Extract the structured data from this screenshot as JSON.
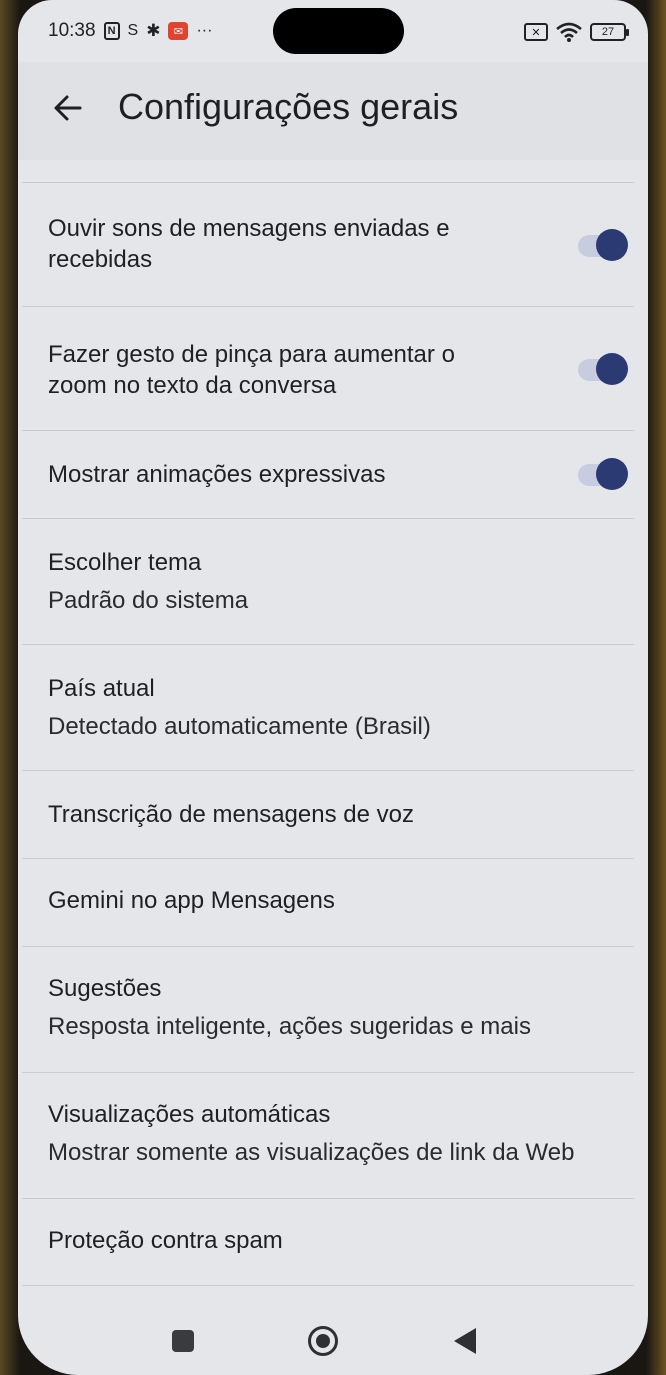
{
  "status_bar": {
    "time": "10:38",
    "icons_left": [
      "nfc-icon",
      "s-icon",
      "gear-icon",
      "mail-icon",
      "more-icon"
    ],
    "icons_right": [
      "sim-icon",
      "wifi-icon",
      "battery-icon"
    ],
    "battery_level": "27"
  },
  "header": {
    "back_icon": "arrow-left-icon",
    "title": "Configurações gerais"
  },
  "settings": [
    {
      "title": "Ouvir sons de mensagens enviadas e",
      "title2": "recebidas",
      "toggle": true
    },
    {
      "title": "Fazer gesto de pinça para aumentar o",
      "title2": "zoom no texto da conversa",
      "toggle": true
    },
    {
      "title": "Mostrar animações expressivas",
      "toggle": true
    },
    {
      "title": "Escolher tema",
      "subtitle": "Padrão do sistema"
    },
    {
      "title": "País atual",
      "subtitle": "Detectado automaticamente (Brasil)"
    },
    {
      "title": "Transcrição de mensagens de voz"
    },
    {
      "title": "Gemini no app Mensagens"
    },
    {
      "title": "Sugestões",
      "subtitle": "Resposta inteligente, ações sugeridas e mais"
    },
    {
      "title": "Visualizações automáticas",
      "subtitle": "Mostrar somente as visualizações de link da Web"
    },
    {
      "title": "Proteção contra spam"
    }
  ],
  "nav_bar": {
    "buttons": [
      "recents-square-icon",
      "home-circle-icon",
      "back-triangle-icon"
    ]
  },
  "colors": {
    "background": "#e4e6ea",
    "toggle_thumb": "#2b3a72",
    "toggle_track": "#c8cce0",
    "divider": "#c9cbcf"
  }
}
